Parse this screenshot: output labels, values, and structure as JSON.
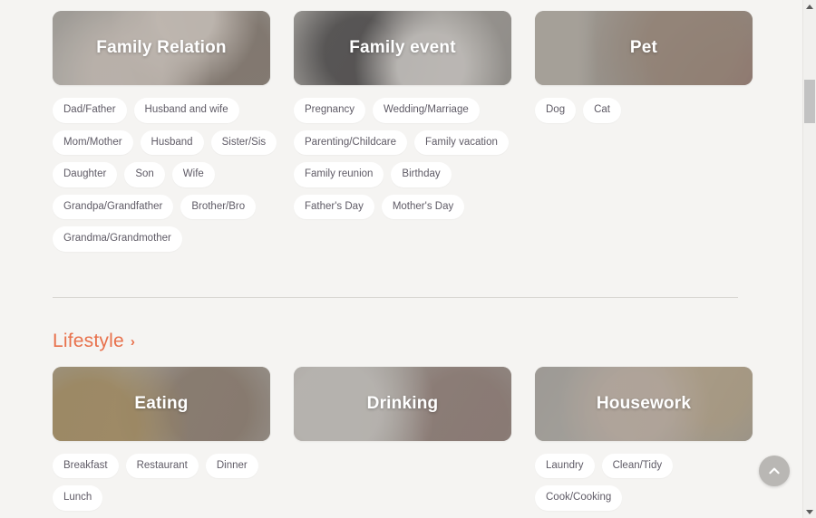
{
  "page": {
    "background_color": "#f5f4f2",
    "accent_color": "#e8714c",
    "tag_text_color": "#5f5b66"
  },
  "sections": [
    {
      "id": "family",
      "header_visible": false,
      "columns": [
        {
          "card": {
            "title": "Family Relation",
            "photo": "family-relation-photo"
          },
          "tags": [
            "Dad/Father",
            "Husband and wife",
            "Mom/Mother",
            "Husband",
            "Sister/Sis",
            "Daughter",
            "Son",
            "Wife",
            "Grandpa/Grandfather",
            "Brother/Bro",
            "Grandma/Grandmother"
          ]
        },
        {
          "card": {
            "title": "Family event",
            "photo": "family-event-photo"
          },
          "tags": [
            "Pregnancy",
            "Wedding/Marriage",
            "Parenting/Childcare",
            "Family vacation",
            "Family reunion",
            "Birthday",
            "Father's Day",
            "Mother's Day"
          ]
        },
        {
          "card": {
            "title": "Pet",
            "photo": "pet-photo"
          },
          "tags": [
            "Dog",
            "Cat"
          ]
        }
      ]
    },
    {
      "id": "lifestyle",
      "header_visible": true,
      "header": {
        "title": "Lifestyle",
        "chevron": "chevron-right-icon",
        "chevron_glyph": "›"
      },
      "columns": [
        {
          "card": {
            "title": "Eating",
            "photo": "eating-photo"
          },
          "tags": [
            "Breakfast",
            "Restaurant",
            "Dinner",
            "Lunch"
          ]
        },
        {
          "card": {
            "title": "Drinking",
            "photo": "drinking-photo"
          },
          "tags": []
        },
        {
          "card": {
            "title": "Housework",
            "photo": "housework-photo"
          },
          "tags": [
            "Laundry",
            "Clean/Tidy",
            "Cook/Cooking"
          ]
        }
      ]
    }
  ],
  "scroll_top_button": {
    "icon": "chevron-up-icon",
    "color": "#b9b7b4"
  },
  "scrollbar": {
    "up_arrow_icon": "scrollbar-arrow-up-icon",
    "down_arrow_icon": "scrollbar-arrow-down-icon",
    "thumb_color": "#c2c2c2",
    "track_color": "#f1f0ee"
  }
}
